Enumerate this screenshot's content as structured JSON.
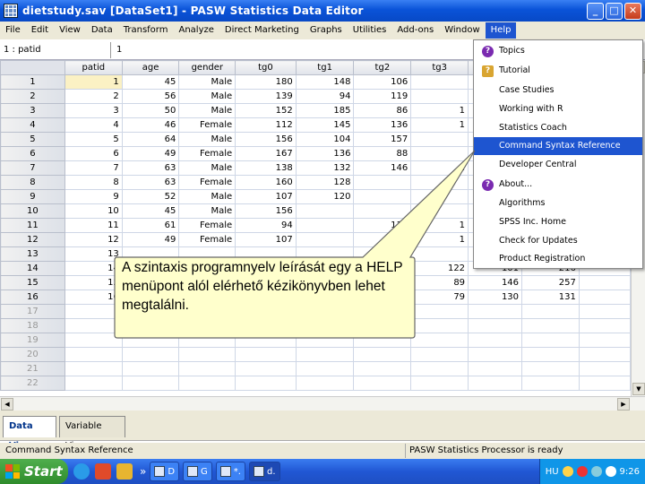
{
  "window": {
    "title": "dietstudy.sav [DataSet1] - PASW Statistics Data Editor",
    "controls": [
      "_",
      "□",
      "✕"
    ]
  },
  "menu": [
    "File",
    "Edit",
    "View",
    "Data",
    "Transform",
    "Analyze",
    "Direct Marketing",
    "Graphs",
    "Utilities",
    "Add-ons",
    "Window",
    "Help"
  ],
  "cell_bar": {
    "ref": "1 : patid",
    "value": "1"
  },
  "grid": {
    "columns": [
      "patid",
      "age",
      "gender",
      "tg0",
      "tg1",
      "tg2",
      "tg3"
    ],
    "rows": [
      [
        "1",
        "45",
        "Male",
        "180",
        "148",
        "106",
        ""
      ],
      [
        "2",
        "56",
        "Male",
        "139",
        "94",
        "119",
        ""
      ],
      [
        "3",
        "50",
        "Male",
        "152",
        "185",
        "86",
        "1"
      ],
      [
        "4",
        "46",
        "Female",
        "112",
        "145",
        "136",
        "1"
      ],
      [
        "5",
        "64",
        "Male",
        "156",
        "104",
        "157",
        ""
      ],
      [
        "6",
        "49",
        "Female",
        "167",
        "136",
        "88",
        ""
      ],
      [
        "7",
        "63",
        "Male",
        "138",
        "132",
        "146",
        "1"
      ],
      [
        "8",
        "63",
        "Female",
        "160",
        "128",
        "",
        ""
      ],
      [
        "9",
        "52",
        "Male",
        "107",
        "120",
        "",
        ""
      ],
      [
        "10",
        "45",
        "Male",
        "156",
        "",
        ""
      ],
      [
        "11",
        "61",
        "Female",
        "94",
        "",
        "114",
        "1"
      ],
      [
        "12",
        "49",
        "Female",
        "107",
        "",
        "156",
        "1"
      ],
      [
        "13",
        "",
        "",
        "",
        "",
        "109",
        ""
      ],
      [
        "14",
        "",
        "",
        "",
        "",
        "28",
        "122",
        "101",
        "216"
      ],
      [
        "15",
        "",
        "",
        "",
        "",
        "93",
        "89",
        "146",
        "257"
      ],
      [
        "16",
        "",
        "",
        "",
        "",
        "7",
        "79",
        "130",
        "131"
      ]
    ],
    "row_numbers": [
      "1",
      "2",
      "3",
      "4",
      "5",
      "6",
      "7",
      "8",
      "9",
      "10",
      "11",
      "12",
      "13",
      "14",
      "15",
      "16",
      "17",
      "18",
      "19",
      "20",
      "21",
      "22"
    ]
  },
  "help_menu": {
    "items": [
      "Topics",
      "Tutorial",
      "Case Studies",
      "Working with R",
      "Statistics Coach",
      "Command Syntax Reference",
      "Developer Central",
      "About...",
      "Algorithms",
      "SPSS Inc. Home",
      "Check for Updates",
      "Product Registration"
    ],
    "highlighted": "Command Syntax Reference"
  },
  "callout": {
    "text": "A szintaxis programnyelv leírását egy a HELP menüpont alól elérhető kézikönyvben lehet megtalálni."
  },
  "tabs": {
    "data_view": "Data View",
    "variable_view": "Variable View"
  },
  "status": {
    "left": "Command Syntax Reference",
    "right": "PASW Statistics Processor is ready"
  },
  "taskbar": {
    "start": "Start",
    "chevron": "»",
    "buttons": [
      "D",
      "G",
      "*.",
      "d."
    ],
    "lang": "HU",
    "clock": "9:26"
  },
  "colors": {
    "highlight": "#1e55d0",
    "selected_cell": "#fbf1c4",
    "callout_fill": "#ffffcc"
  }
}
